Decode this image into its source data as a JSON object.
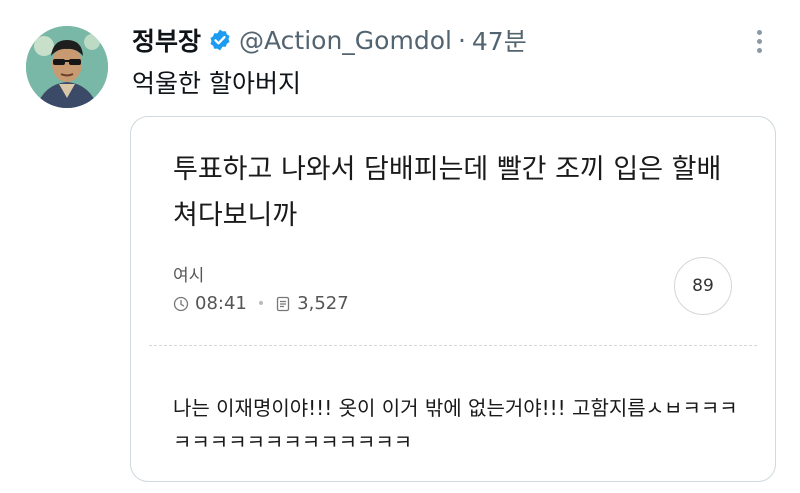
{
  "tweet": {
    "display_name": "정부장",
    "handle": "@Action_Gomdol",
    "separator": "·",
    "time": "47분",
    "text": "억울한 할아버지"
  },
  "card": {
    "title": "투표하고 나와서 담배피는데 빨간 조끼 입은 할배 쳐다보니까",
    "author": "여시",
    "time": "08:41",
    "views": "3,527",
    "comments": "89",
    "body": "나는 이재명이야!!! 옷이 이거 밖에 없는거야!!! 고함지름ㅅㅂㅋㅋㅋㅋㅋㅋㅋㅋㅋㅋㅋㅋㅋㅋㅋㅋ"
  },
  "icons": {
    "verified": "verified-badge-icon",
    "more": "more-options-icon",
    "clock": "clock-icon",
    "views": "document-icon"
  },
  "colors": {
    "verified": "#1d9bf0",
    "secondary_text": "#536471",
    "border": "#cfd9de"
  }
}
